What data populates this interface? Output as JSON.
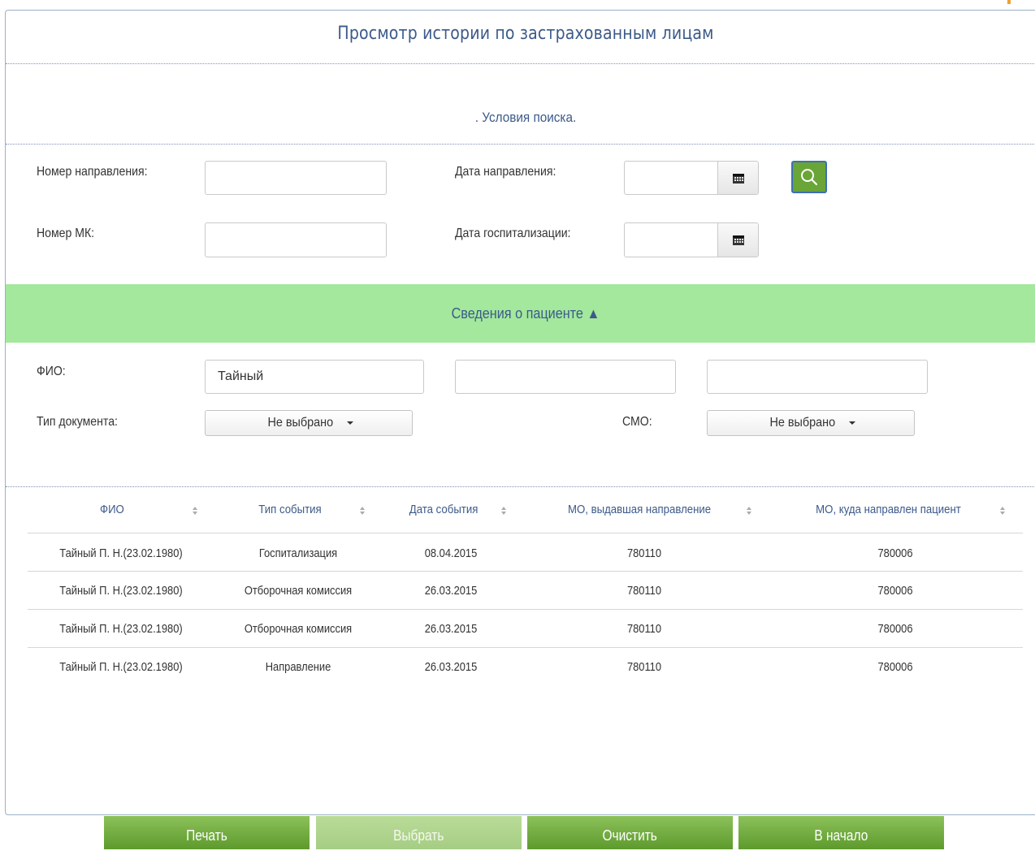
{
  "page": {
    "title": "Просмотр истории по застрахованным лицам"
  },
  "search": {
    "section_title": ". Условия поиска.",
    "referral_number_label": "Номер направления:",
    "referral_number_value": "",
    "mk_number_label": "Номер МК:",
    "mk_number_value": "",
    "referral_date_label": "Дата направления:",
    "referral_date_value": "",
    "hospitalization_date_label": "Дата госпитализации:",
    "hospitalization_date_value": ""
  },
  "patient": {
    "section_title": "Сведения о пациенте ▲",
    "fio_label": "ФИО:",
    "last_name": "Тайный",
    "first_name": "",
    "middle_name": "",
    "doc_type_label": "Тип документа:",
    "doc_type_value": "Не выбрано",
    "smo_label": "СМО:",
    "smo_value": "Не выбрано"
  },
  "table": {
    "columns": [
      "ФИО",
      "Тип события",
      "Дата события",
      "МО, выдавшая направление",
      "МО, куда направлен пациент"
    ],
    "rows": [
      [
        "Тайный П. Н.(23.02.1980)",
        "Госпитализация",
        "08.04.2015",
        "780110",
        "780006"
      ],
      [
        "Тайный П. Н.(23.02.1980)",
        "Отборочная комиссия",
        "26.03.2015",
        "780110",
        "780006"
      ],
      [
        "Тайный П. Н.(23.02.1980)",
        "Отборочная комиссия",
        "26.03.2015",
        "780110",
        "780006"
      ],
      [
        "Тайный П. Н.(23.02.1980)",
        "Направление",
        "26.03.2015",
        "780110",
        "780006"
      ]
    ]
  },
  "footer": {
    "print_label": "Печать",
    "select_label": "Выбрать",
    "clear_label": "Очистить",
    "home_label": "В начало"
  },
  "colors": {
    "accent_green": "#a3e89c",
    "button_green": "#6aa537",
    "title_blue": "#3c5a8a"
  },
  "icons": {
    "calendar": "calendar-icon",
    "search": "search-icon",
    "sort": "sort-icon",
    "dropdown": "caret-down-icon"
  }
}
